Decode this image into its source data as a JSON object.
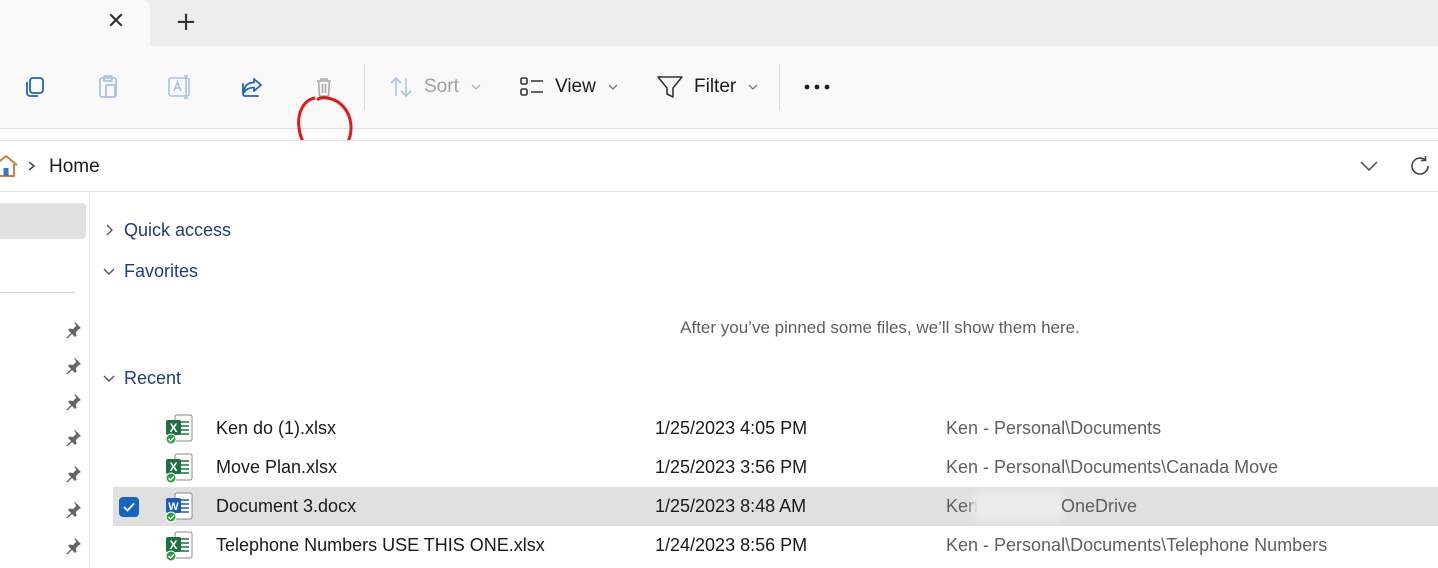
{
  "tabs": {
    "close_glyph": "✕",
    "new_tab_glyph": "+"
  },
  "toolbar": {
    "sort_label": "Sort",
    "view_label": "View",
    "filter_label": "Filter",
    "icons": [
      "copy-icon",
      "paste-icon",
      "rename-icon",
      "share-icon",
      "delete-icon",
      "sort-icon",
      "view-icon",
      "filter-icon",
      "more-icon"
    ],
    "annotation_color": "#e0191b"
  },
  "address_bar": {
    "breadcrumb": "Home"
  },
  "main": {
    "sections": {
      "quick_access": "Quick access",
      "favorites": "Favorites",
      "recent": "Recent"
    },
    "favorites_empty": "After you’ve pinned some files, we’ll show them here.",
    "recent_files": [
      {
        "name": "Ken do (1).xlsx",
        "date": "1/25/2023 4:05 PM",
        "location": "Ken - Personal\\Documents",
        "type": "excel",
        "selected": false
      },
      {
        "name": "Move Plan.xlsx",
        "date": "1/25/2023 3:56 PM",
        "location": "Ken - Personal\\Documents\\Canada Move",
        "type": "excel",
        "selected": false
      },
      {
        "name": "Document 3.docx",
        "date": "1/25/2023 8:48 AM",
        "location_start": "Ken",
        "location_end": "OneDrive",
        "type": "word",
        "selected": true
      },
      {
        "name": "Telephone Numbers USE THIS ONE.xlsx",
        "date": "1/24/2023 8:56 PM",
        "location": "Ken - Personal\\Documents\\Telephone Numbers",
        "type": "excel",
        "selected": false
      }
    ]
  },
  "colors": {
    "accent": "#1565c0",
    "section_text": "#1f3d7a",
    "excel_green": "#1d7044",
    "word_blue": "#185abd",
    "sync_green": "#2e9e3e"
  }
}
